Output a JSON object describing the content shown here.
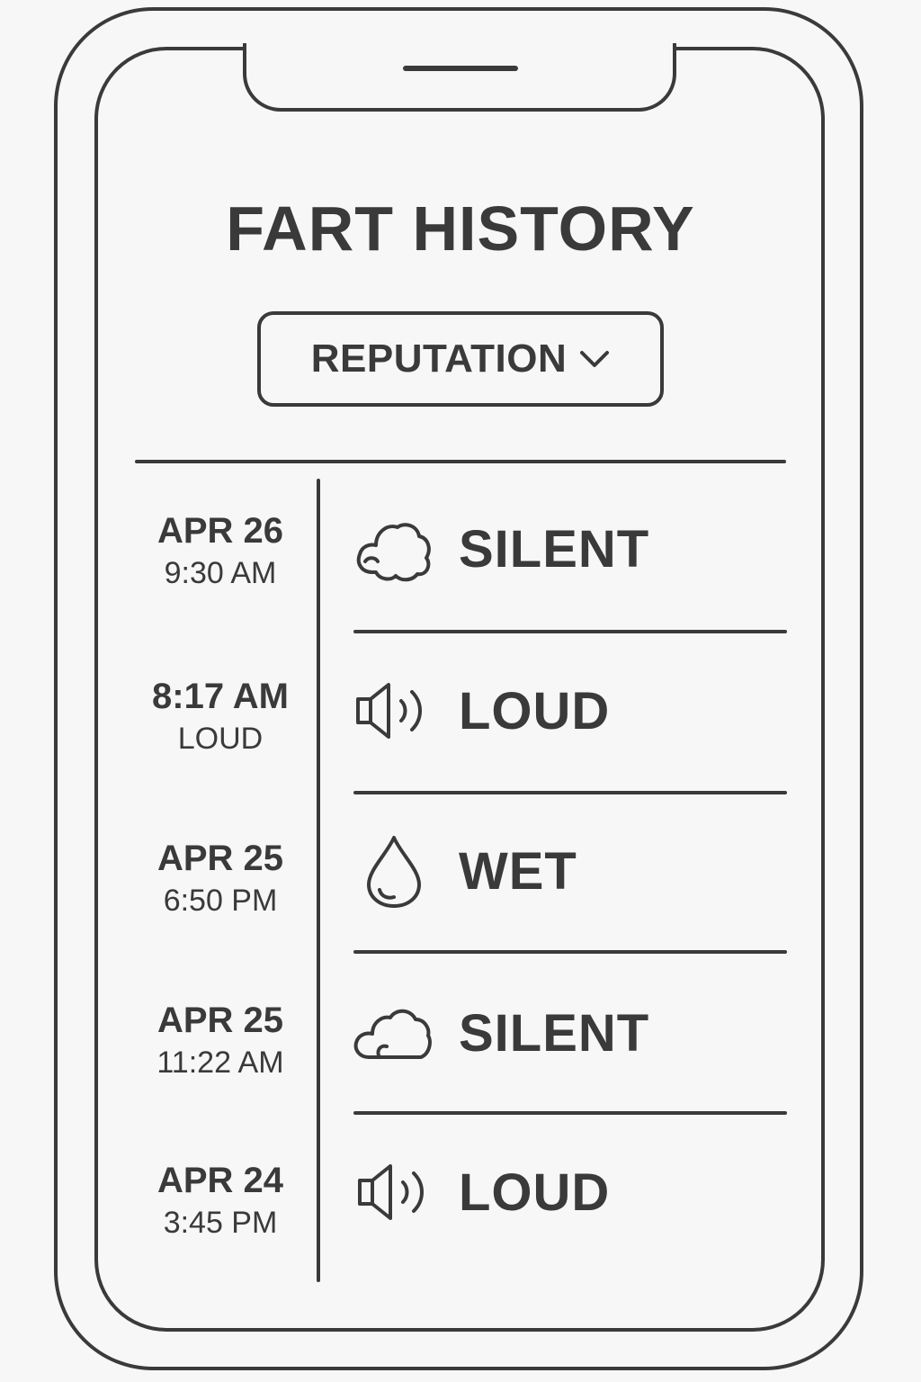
{
  "app": {
    "title": "FART HISTORY"
  },
  "filter": {
    "label": "REPUTATION",
    "icon": "chevron-down-icon"
  },
  "entries": [
    {
      "date": "APR 26",
      "time": "9:30 AM",
      "type": "SILENT",
      "icon": "cloud-icon"
    },
    {
      "date": "8:17 AM",
      "time": "LOUD",
      "type": "LOUD",
      "icon": "speaker-icon"
    },
    {
      "date": "APR 25",
      "time": "6:50 PM",
      "type": "WET",
      "icon": "droplet-icon"
    },
    {
      "date": "APR 25",
      "time": "11:22 AM",
      "type": "SILENT",
      "icon": "cloud-icon"
    },
    {
      "date": "APR 24",
      "time": "3:45 PM",
      "type": "LOUD",
      "icon": "speaker-icon"
    }
  ],
  "colors": {
    "stroke": "#3a3a3a",
    "background": "#f7f7f7"
  }
}
